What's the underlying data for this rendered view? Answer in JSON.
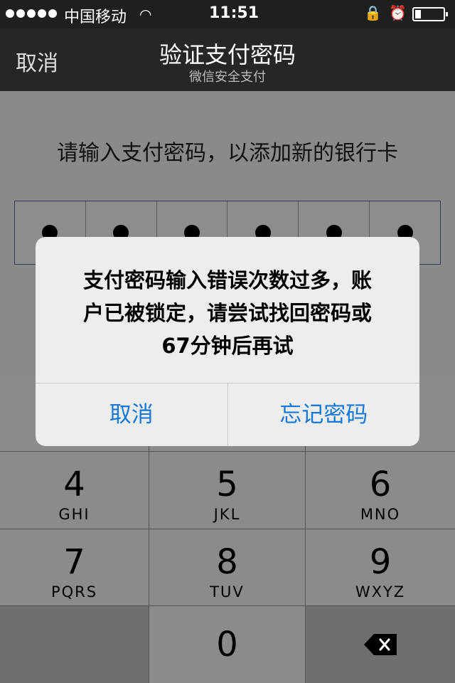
{
  "status_bar": {
    "carrier": "中国移动",
    "time": "11:51",
    "battery_level": 0.2
  },
  "nav": {
    "cancel_label": "取消",
    "title": "验证支付密码",
    "subtitle": "微信安全支付"
  },
  "content": {
    "prompt": "请输入支付密码，以添加新的银行卡",
    "pin_entered": 6
  },
  "alert": {
    "line1": "支付密码输入错误次数过多，账",
    "line2": "户已被锁定，请尝试找回密码或",
    "line3": "67分钟后再试",
    "cancel_label": "取消",
    "forgot_label": "忘记密码"
  },
  "keypad": {
    "keys": [
      {
        "num": "4",
        "letters": "GHI"
      },
      {
        "num": "5",
        "letters": "JKL"
      },
      {
        "num": "6",
        "letters": "MNO"
      },
      {
        "num": "7",
        "letters": "PQRS"
      },
      {
        "num": "8",
        "letters": "TUV"
      },
      {
        "num": "9",
        "letters": "WXYZ"
      },
      {
        "num": "0",
        "letters": ""
      }
    ]
  },
  "colors": {
    "accent": "#1478d9",
    "navbar": "#262626"
  }
}
